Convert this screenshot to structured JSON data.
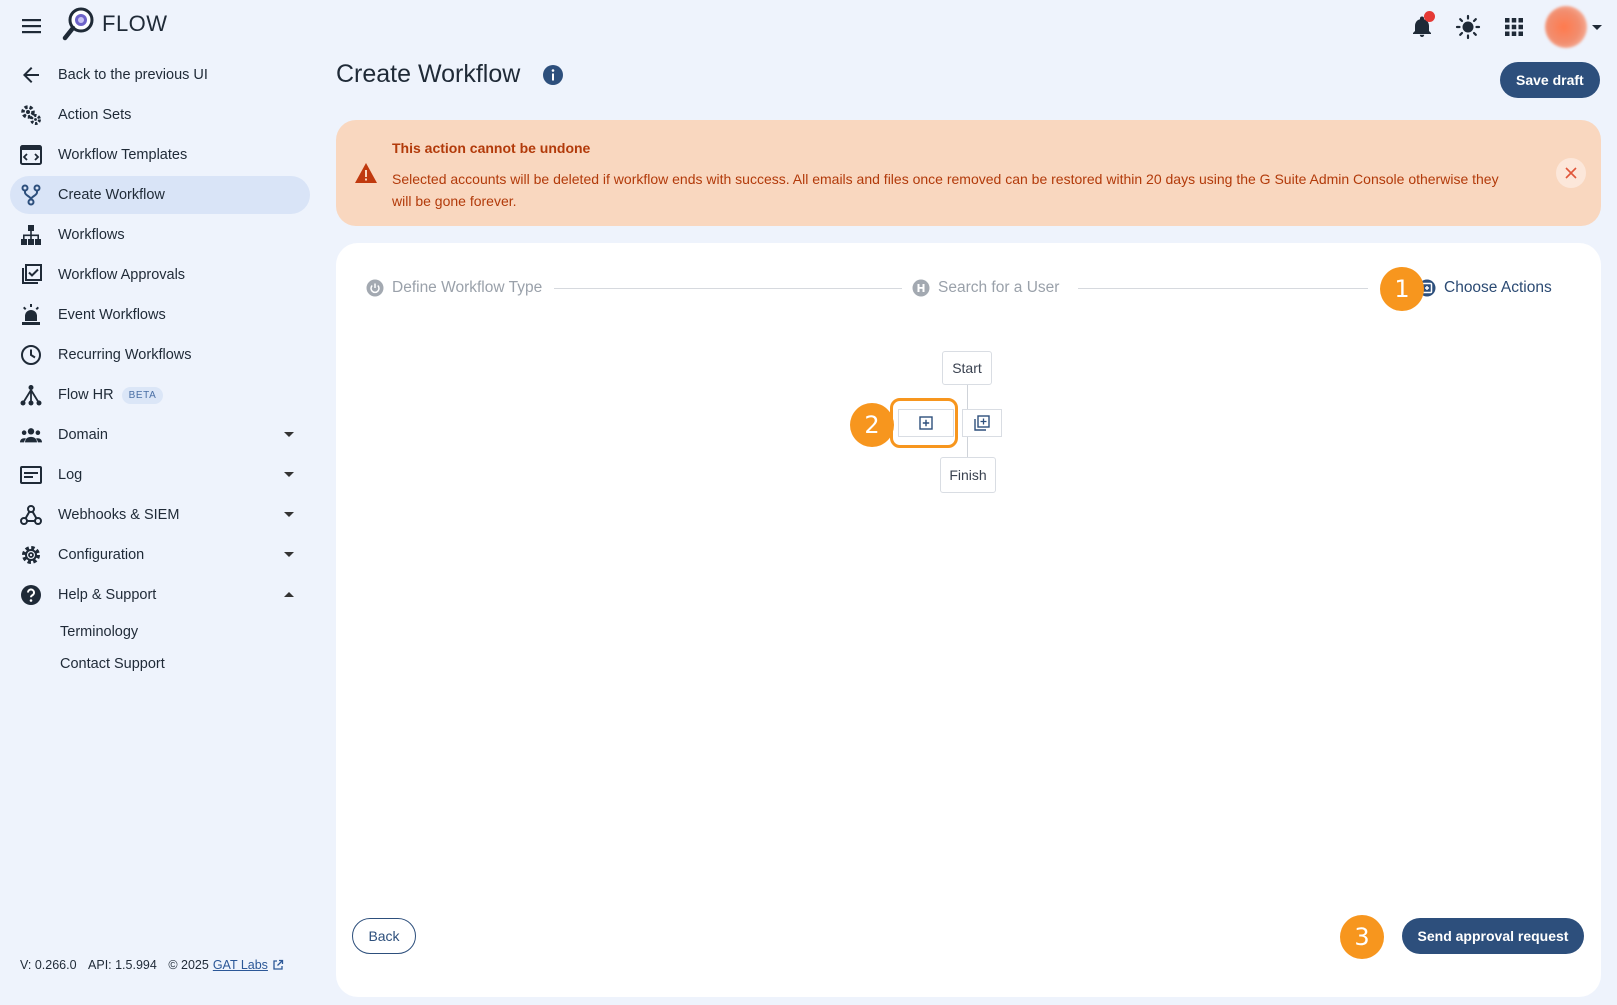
{
  "app": {
    "name": "FLOW"
  },
  "sidebar": {
    "items": [
      {
        "label": "Back to the previous UI",
        "icon": "arrow-left-icon"
      },
      {
        "label": "Action Sets",
        "icon": "gears-icon"
      },
      {
        "label": "Workflow Templates",
        "icon": "template-icon"
      },
      {
        "label": "Create Workflow",
        "icon": "workflow-branch-icon",
        "active": true
      },
      {
        "label": "Workflows",
        "icon": "hierarchy-icon"
      },
      {
        "label": "Workflow Approvals",
        "icon": "approval-check-icon"
      },
      {
        "label": "Event Workflows",
        "icon": "alarm-light-icon"
      },
      {
        "label": "Recurring Workflows",
        "icon": "clock-icon"
      },
      {
        "label": "Flow HR",
        "icon": "hr-network-icon",
        "badge": "BETA"
      },
      {
        "label": "Domain",
        "icon": "users-group-icon"
      },
      {
        "label": "Log",
        "icon": "log-icon"
      },
      {
        "label": "Webhooks & SIEM",
        "icon": "webhook-icon"
      },
      {
        "label": "Configuration",
        "icon": "gear-icon"
      },
      {
        "label": "Help & Support",
        "icon": "help-circle-icon"
      }
    ],
    "help_sub": [
      "Terminology",
      "Contact Support"
    ]
  },
  "footer": {
    "version": "V: 0.266.0",
    "api": "API: 1.5.994",
    "copyright": "© 2025",
    "link": "GAT Labs"
  },
  "page": {
    "title": "Create Workflow",
    "save_draft": "Save draft"
  },
  "alert": {
    "title": "This action cannot be undone",
    "text": "Selected accounts will be deleted if workflow ends with success. All emails and files once removed can be restored within 20 days using the G Suite Admin Console otherwise they will be gone forever."
  },
  "stepper": {
    "steps": [
      {
        "label": "Define Workflow Type"
      },
      {
        "label": "Search for a User"
      },
      {
        "label": "Choose Actions"
      }
    ]
  },
  "flow": {
    "start": "Start",
    "finish": "Finish"
  },
  "annotations": [
    "1",
    "2",
    "3"
  ],
  "buttons": {
    "back": "Back",
    "send": "Send approval request"
  },
  "colors": {
    "primary": "#2d4f7c",
    "accent": "#f7961e",
    "alert_bg": "#f9d7bf",
    "alert_text": "#b23a0a",
    "notification": "#e53935"
  }
}
